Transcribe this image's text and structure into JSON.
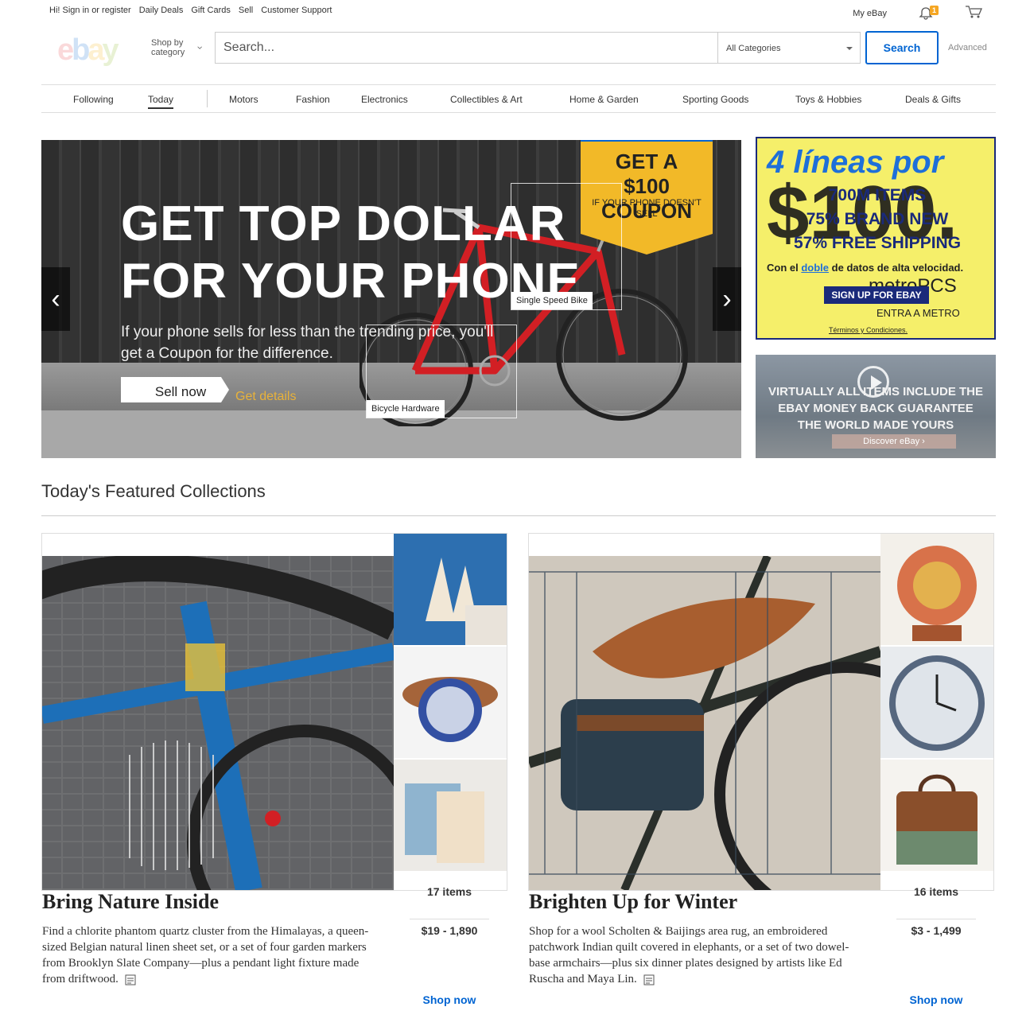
{
  "topbar": {
    "greeting": "Hi! Sign in or register",
    "links": [
      "Daily Deals",
      "Gift Cards",
      "Sell",
      "Customer Support"
    ],
    "my_ebay": "My eBay",
    "notification_count": "1"
  },
  "header": {
    "shop_by_category": "Shop by category",
    "search_placeholder": "Search...",
    "category_select": "All Categories",
    "search_button": "Search",
    "advanced": "Advanced"
  },
  "nav": {
    "items": [
      "Following",
      "Today",
      "Motors",
      "Fashion",
      "Electronics",
      "Collectibles & Art",
      "Home & Garden",
      "Sporting Goods",
      "Toys & Hobbies",
      "Deals & Gifts"
    ],
    "active": "Today"
  },
  "hero": {
    "title_line1": "GET TOP DOLLAR",
    "title_line2": "FOR YOUR PHONE",
    "subtitle": "If your phone sells for less than the trending price, you'll get a Coupon for the difference.",
    "sell_button": "Sell now",
    "details_link": "Get details",
    "coupon_line1": "GET A",
    "coupon_line2": "$100 COUPON",
    "coupon_sub": "IF YOUR PHONE DOESN'T SELL",
    "tag1": "Single Speed Bike",
    "tag2": "Bicycle Hardware",
    "prev": "‹",
    "next": "›"
  },
  "ad_metro": {
    "headline": "4 líneas por",
    "price": "$100.",
    "line1": "700M ITEMS",
    "line2": "75% BRAND NEW",
    "line3": "57% FREE SHIPPING",
    "body_pre": "Con el",
    "body_doble": "doble",
    "body_post": "de datos de alta velocidad.",
    "brand": "metroPCS",
    "signup": "SIGN UP FOR EBAY",
    "entra": "ENTRA A METRO",
    "terms": "Términos y Condiciones."
  },
  "ad_guarantee": {
    "line1": "VIRTUALLY ALL ITEMS INCLUDE THE",
    "line2": "EBAY MONEY BACK GUARANTEE",
    "line3": "THE WORLD MADE YOURS",
    "discover": "Discover eBay ›"
  },
  "featured": {
    "title": "Today's Featured Collections",
    "collections": [
      {
        "title": "Bring Nature Inside",
        "description": "Find a chlorite phantom quartz cluster from the Himalayas, a queen-sized Belgian natural linen sheet set, or a set of four garden markers from Brooklyn Slate Company—plus a pendant light fixture made from driftwood.",
        "count": "17 items",
        "price": "$19 - 1,890",
        "shop": "Shop now"
      },
      {
        "title": "Brighten Up for Winter",
        "description": "Shop for a wool Scholten & Baijings area rug, an embroidered patchwork Indian quilt covered in elephants, or a set of two dowel-base armchairs—plus six dinner plates designed by artists like Ed Ruscha and Maya Lin.",
        "count": "16 items",
        "price": "$3 - 1,499",
        "shop": "Shop now"
      }
    ]
  }
}
